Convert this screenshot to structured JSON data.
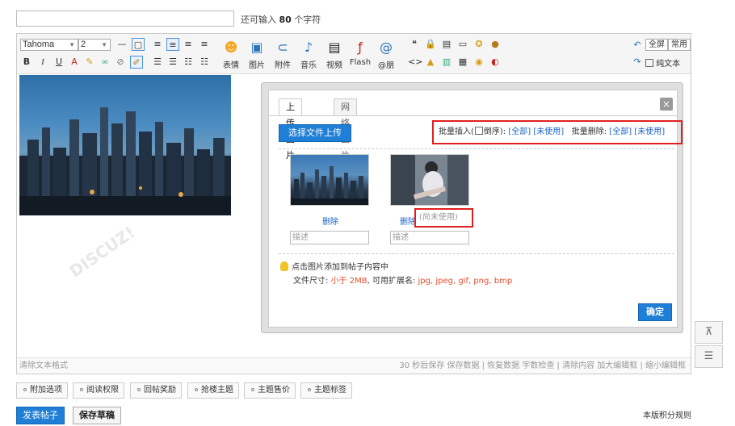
{
  "counter": {
    "prefix": "还可输入",
    "count": "80",
    "suffix": "个字符"
  },
  "toolbar": {
    "font_name": "Tahoma",
    "font_size": "2",
    "fmt_buttons": [
      "B",
      "I",
      "U"
    ],
    "big_buttons": [
      {
        "label": "表情",
        "icon": "smiley-icon"
      },
      {
        "label": "图片",
        "icon": "image-icon"
      },
      {
        "label": "附件",
        "icon": "paperclip-icon"
      },
      {
        "label": "音乐",
        "icon": "music-icon"
      },
      {
        "label": "视频",
        "icon": "film-icon"
      },
      {
        "label": "Flash",
        "icon": "flash-icon"
      },
      {
        "label": "@朋",
        "icon": "at-icon"
      }
    ],
    "fullscreen_label": "全屏",
    "common_label": "常用",
    "plaintext_label": "纯文本"
  },
  "footer": {
    "clear_format": "清除文本格式",
    "right": "30 秒后保存 保存数据 | 恢复数据 字数检查 | 清除内容 加大编辑框 | 缩小编辑框"
  },
  "dialog": {
    "tabs": [
      "上传图片",
      "网络图片"
    ],
    "close": "×",
    "upload_label": "选择文件上传",
    "batch": {
      "insert": "批量插入(",
      "reverse": "倒序):",
      "all": "[全部]",
      "unused": "[未使用]",
      "delete": "批量删除:",
      "all2": "[全部]",
      "unused2": "[未使用]"
    },
    "delete_label": "删除",
    "unused_tag": "(尚未使用)",
    "desc_placeholder": "描述",
    "hint": "点击图片添加到帖子内容中",
    "fileinfo_prefix": "文件尺寸:",
    "fileinfo_size": "小于 2MB",
    "fileinfo_mid": ", 可用扩展名:",
    "fileinfo_ext": "jpg, jpeg, gif, png, bmp",
    "ok_label": "确定"
  },
  "options": [
    "附加选项",
    "阅读权限",
    "回帖奖励",
    "抢楼主题",
    "主题售价",
    "主题标签"
  ],
  "actions": {
    "post": "发表帖子",
    "draft": "保存草稿",
    "rules": "本版积分规则"
  }
}
